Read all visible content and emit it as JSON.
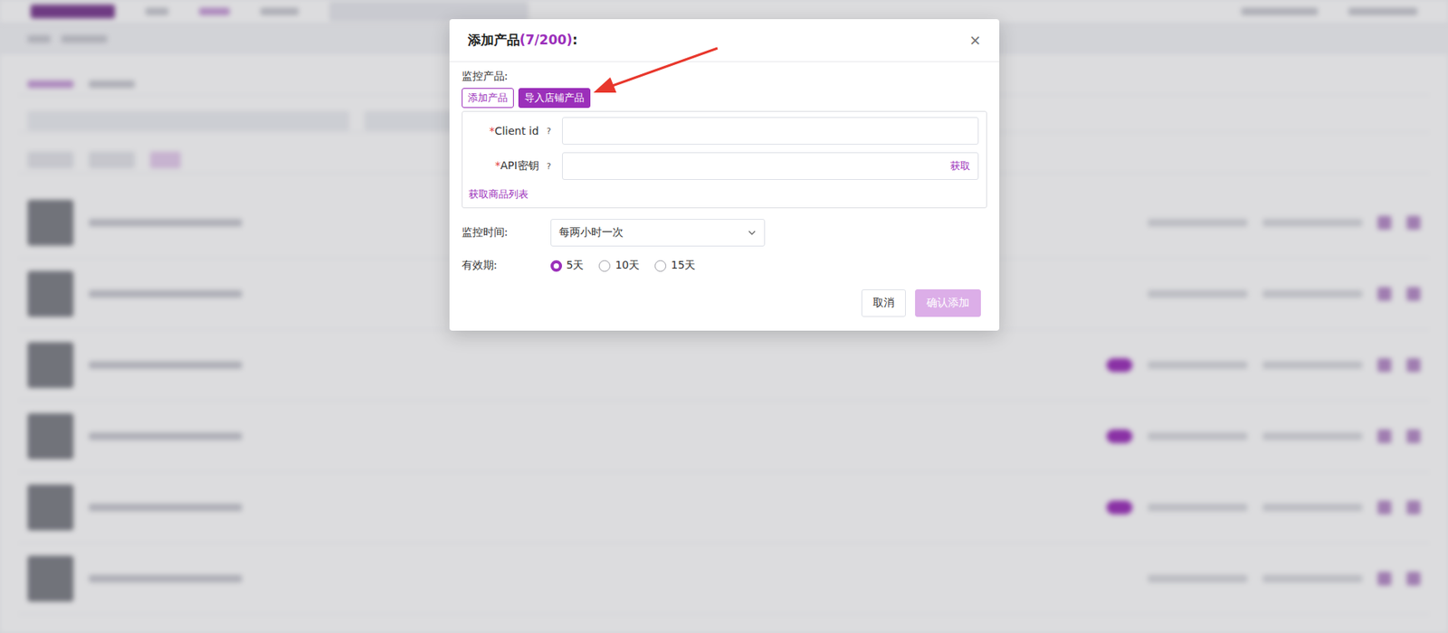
{
  "dialog": {
    "title": "添加产品",
    "count": "(7/200)",
    "suffix": ":",
    "close": "×"
  },
  "monitor_label": "监控产品:",
  "source_buttons": [
    {
      "label": "添加产品",
      "selected": false
    },
    {
      "label": "导入店铺产品",
      "selected": true
    }
  ],
  "credentials": {
    "required_mark": "*",
    "fields": [
      {
        "label": "Client id",
        "help": "?",
        "value": "",
        "action": ""
      },
      {
        "label": "API密钥",
        "help": "?",
        "value": "",
        "action": "获取"
      }
    ],
    "fetch_link": "获取商品列表"
  },
  "schedule": {
    "label": "监控时间:",
    "value": "每两小时一次"
  },
  "validity": {
    "label": "有效期:",
    "options": [
      {
        "label": "5天",
        "selected": true
      },
      {
        "label": "10天",
        "selected": false
      },
      {
        "label": "15天",
        "selected": false
      }
    ]
  },
  "buttons": [
    {
      "label": "取消",
      "kind": "secondary",
      "disabled": false
    },
    {
      "label": "确认添加",
      "kind": "primary",
      "disabled": true
    }
  ],
  "background": {
    "rows": [
      {
        "switch_on": false
      },
      {
        "switch_on": false
      },
      {
        "switch_on": true
      },
      {
        "switch_on": true
      },
      {
        "switch_on": true
      },
      {
        "switch_on": false
      }
    ]
  }
}
